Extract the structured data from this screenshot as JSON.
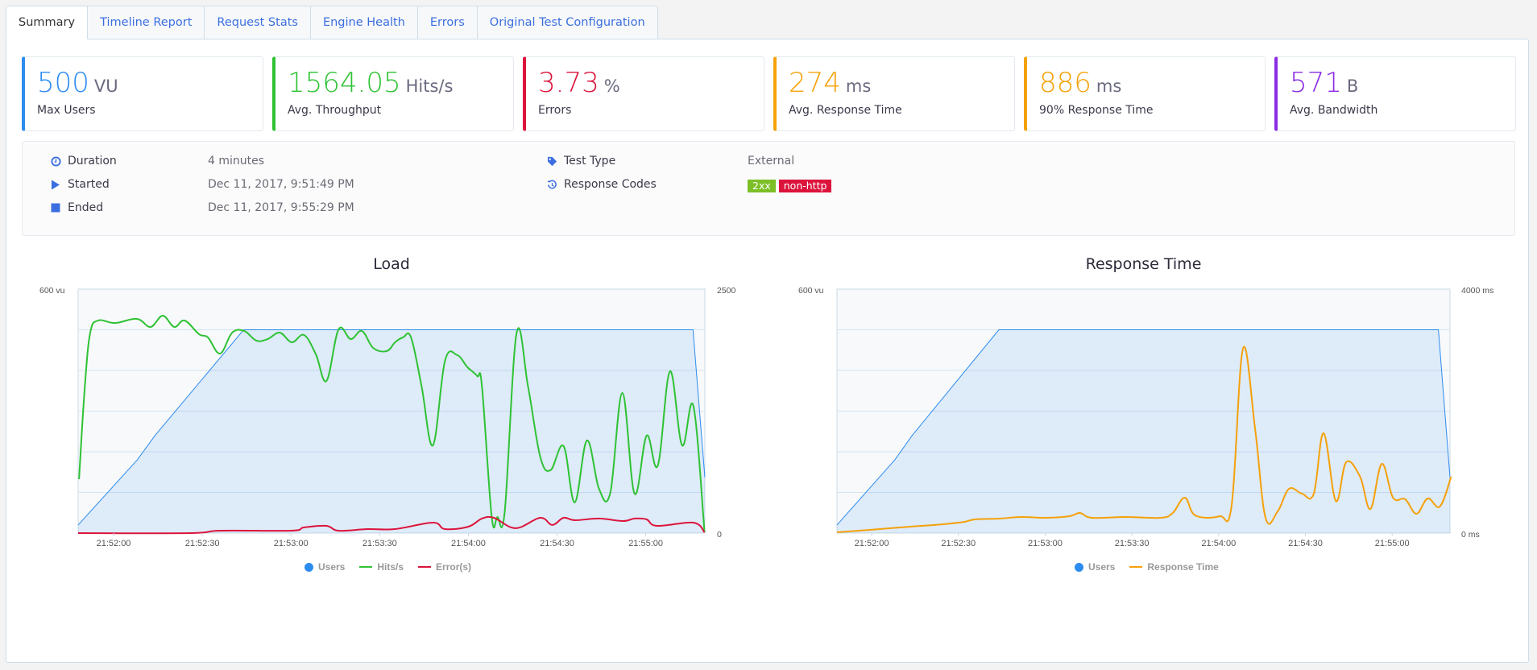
{
  "tabs": [
    {
      "label": "Summary",
      "active": true
    },
    {
      "label": "Timeline Report",
      "active": false
    },
    {
      "label": "Request Stats",
      "active": false
    },
    {
      "label": "Engine Health",
      "active": false
    },
    {
      "label": "Errors",
      "active": false
    },
    {
      "label": "Original Test Configuration",
      "active": false
    }
  ],
  "cards": [
    {
      "value": "500",
      "unit": "VU",
      "label": "Max Users",
      "color": "#2d8cf0"
    },
    {
      "value": "1564.05",
      "unit": "Hits/s",
      "label": "Avg. Throughput",
      "color": "#2fc234"
    },
    {
      "value": "3.73",
      "unit": "%",
      "label": "Errors",
      "color": "#dc143c"
    },
    {
      "value": "274",
      "unit": "ms",
      "label": "Avg. Response Time",
      "color": "#f5a10a"
    },
    {
      "value": "886",
      "unit": "ms",
      "label": "90% Response Time",
      "color": "#f5a10a"
    },
    {
      "value": "571",
      "unit": "B",
      "label": "Avg. Bandwidth",
      "color": "#8a2be2"
    }
  ],
  "info": {
    "duration": {
      "label": "Duration",
      "value": "4 minutes",
      "icon": "clock-icon"
    },
    "started": {
      "label": "Started",
      "value": "Dec 11, 2017, 9:51:49 PM",
      "icon": "play-icon"
    },
    "ended": {
      "label": "Ended",
      "value": "Dec 11, 2017, 9:55:29 PM",
      "icon": "stop-icon"
    },
    "test_type": {
      "label": "Test Type",
      "value": "External",
      "icon": "tag-icon"
    },
    "response_codes": {
      "label": "Response Codes",
      "icon": "history-icon",
      "badges": [
        {
          "text": "2xx",
          "color": "#7cbf26"
        },
        {
          "text": "non-http",
          "color": "#dc143c"
        }
      ]
    }
  },
  "colors": {
    "users": "#2d8cf0",
    "hits": "#2fc234",
    "errors": "#dc143c",
    "response": "#f5a10a"
  },
  "chart_data": [
    {
      "type": "line",
      "title": "Load",
      "x_unit": "seconds since 21:51:48",
      "x_range": [
        0,
        212
      ],
      "x_ticks": [
        {
          "t": 12,
          "label": "21:52:00"
        },
        {
          "t": 42,
          "label": "21:52:30"
        },
        {
          "t": 72,
          "label": "21:53:00"
        },
        {
          "t": 102,
          "label": "21:53:30"
        },
        {
          "t": 132,
          "label": "21:54:00"
        },
        {
          "t": 162,
          "label": "21:54:30"
        },
        {
          "t": 192,
          "label": "21:55:00"
        }
      ],
      "y_left": {
        "label_top": "600 vu",
        "range": [
          0,
          600
        ],
        "gridlines": [
          100,
          200,
          300,
          400,
          500
        ]
      },
      "y_right": {
        "label_top": "2500",
        "label_bottom": "0",
        "range": [
          0,
          2500
        ]
      },
      "grid": true,
      "legend": "bottom-center",
      "series": [
        {
          "name": "Users",
          "axis": "left",
          "style": "area",
          "points": [
            [
              0,
              20
            ],
            [
              20,
              180
            ],
            [
              26,
              240
            ],
            [
              56,
              500
            ],
            [
              208,
              500
            ],
            [
              212,
              137
            ]
          ]
        },
        {
          "name": "Hits/s",
          "axis": "right",
          "style": "line",
          "points": [
            [
              0.3,
              553
            ],
            [
              2.2,
              1477
            ],
            [
              4.1,
              2054
            ],
            [
              6.8,
              2178
            ],
            [
              12.5,
              2153
            ],
            [
              19.9,
              2195
            ],
            [
              24.5,
              2112
            ],
            [
              28.6,
              2228
            ],
            [
              32.5,
              2112
            ],
            [
              36,
              2178
            ],
            [
              40.9,
              2038
            ],
            [
              43.9,
              2005
            ],
            [
              48,
              1840
            ],
            [
              52.1,
              2054
            ],
            [
              56.2,
              2071
            ],
            [
              60.3,
              1972
            ],
            [
              64.1,
              1988
            ],
            [
              68.2,
              2054
            ],
            [
              72.3,
              1955
            ],
            [
              76.4,
              2030
            ],
            [
              80.4,
              1832
            ],
            [
              84,
              1559
            ],
            [
              88.1,
              2087
            ],
            [
              92.2,
              1988
            ],
            [
              96,
              2071
            ],
            [
              99.8,
              1898
            ],
            [
              104.4,
              1865
            ],
            [
              107.2,
              1955
            ],
            [
              109.9,
              2005
            ],
            [
              112.6,
              2005
            ],
            [
              116.2,
              1502
            ],
            [
              120,
              899
            ],
            [
              124.1,
              1766
            ],
            [
              128.2,
              1824
            ],
            [
              131.7,
              1700
            ],
            [
              135,
              1609
            ],
            [
              136.6,
              1502
            ],
            [
              139.9,
              165
            ],
            [
              141.8,
              165
            ],
            [
              144.3,
              223
            ],
            [
              148.3,
              2046
            ],
            [
              152.2,
              1502
            ],
            [
              156.3,
              784
            ],
            [
              159.8,
              644
            ],
            [
              164.2,
              891
            ],
            [
              168,
              314
            ],
            [
              172.1,
              949
            ],
            [
              176.2,
              454
            ],
            [
              180,
              413
            ],
            [
              184.1,
              1436
            ],
            [
              188.2,
              404
            ],
            [
              192.3,
              998
            ],
            [
              196.1,
              693
            ],
            [
              200.2,
              1658
            ],
            [
              204.3,
              899
            ],
            [
              208.1,
              1304
            ],
            [
              211.9,
              8
            ]
          ]
        },
        {
          "name": "Error(s)",
          "axis": "right",
          "style": "line",
          "points": [
            [
              0,
              0
            ],
            [
              38,
              0
            ],
            [
              48,
              25
            ],
            [
              72,
              25
            ],
            [
              76.4,
              58
            ],
            [
              84,
              74
            ],
            [
              88.1,
              25
            ],
            [
              98,
              41
            ],
            [
              107.2,
              41
            ],
            [
              120,
              107
            ],
            [
              124.1,
              41
            ],
            [
              132,
              66
            ],
            [
              136.6,
              149
            ],
            [
              140.6,
              157
            ],
            [
              148,
              50
            ],
            [
              156.3,
              157
            ],
            [
              160.4,
              83
            ],
            [
              164.2,
              157
            ],
            [
              168,
              132
            ],
            [
              176.2,
              149
            ],
            [
              184.3,
              124
            ],
            [
              188.2,
              149
            ],
            [
              192.3,
              140
            ],
            [
              195.8,
              74
            ],
            [
              208.1,
              107
            ],
            [
              211.9,
              8
            ]
          ]
        }
      ]
    },
    {
      "type": "line",
      "title": "Response Time",
      "x_unit": "seconds since 21:51:48",
      "x_range": [
        0,
        212
      ],
      "x_ticks": [
        {
          "t": 12,
          "label": "21:52:00"
        },
        {
          "t": 42,
          "label": "21:52:30"
        },
        {
          "t": 72,
          "label": "21:53:00"
        },
        {
          "t": 102,
          "label": "21:53:30"
        },
        {
          "t": 132,
          "label": "21:54:00"
        },
        {
          "t": 162,
          "label": "21:54:30"
        },
        {
          "t": 192,
          "label": "21:55:00"
        }
      ],
      "y_left": {
        "label_top": "600 vu",
        "range": [
          0,
          600
        ],
        "gridlines": [
          100,
          200,
          300,
          400,
          500
        ]
      },
      "y_right": {
        "label_top": "4000 ms",
        "label_bottom": "0 ms",
        "range": [
          0,
          4000
        ]
      },
      "grid": true,
      "legend": "bottom-center",
      "series": [
        {
          "name": "Users",
          "axis": "left",
          "style": "area",
          "points": [
            [
              0,
              20
            ],
            [
              20,
              180
            ],
            [
              26,
              240
            ],
            [
              56,
              500
            ],
            [
              208,
              500
            ],
            [
              212,
              137
            ]
          ]
        },
        {
          "name": "Response Time",
          "axis": "right",
          "style": "line",
          "points": [
            [
              0,
              13
            ],
            [
              11.4,
              53
            ],
            [
              25.4,
              106
            ],
            [
              36.6,
              145
            ],
            [
              44.1,
              185
            ],
            [
              47.7,
              224
            ],
            [
              56.1,
              238
            ],
            [
              63.6,
              264
            ],
            [
              72.3,
              251
            ],
            [
              80.4,
              277
            ],
            [
              84,
              330
            ],
            [
              88.2,
              251
            ],
            [
              99.9,
              264
            ],
            [
              111.9,
              251
            ],
            [
              116.1,
              330
            ],
            [
              120.3,
              581
            ],
            [
              123.9,
              290
            ],
            [
              132.3,
              277
            ],
            [
              136.5,
              462
            ],
            [
              140.4,
              3023
            ],
            [
              144.6,
              1703
            ],
            [
              148.2,
              251
            ],
            [
              152.4,
              356
            ],
            [
              156.3,
              726
            ],
            [
              160.8,
              647
            ],
            [
              164.9,
              647
            ],
            [
              168.3,
              1637
            ],
            [
              172.5,
              528
            ],
            [
              176.1,
              1162
            ],
            [
              180.9,
              924
            ],
            [
              184.5,
              396
            ],
            [
              188.4,
              1135
            ],
            [
              192.3,
              581
            ],
            [
              196.5,
              554
            ],
            [
              200.4,
              317
            ],
            [
              204.3,
              568
            ],
            [
              208.5,
              436
            ],
            [
              212.4,
              924
            ]
          ]
        }
      ]
    }
  ]
}
